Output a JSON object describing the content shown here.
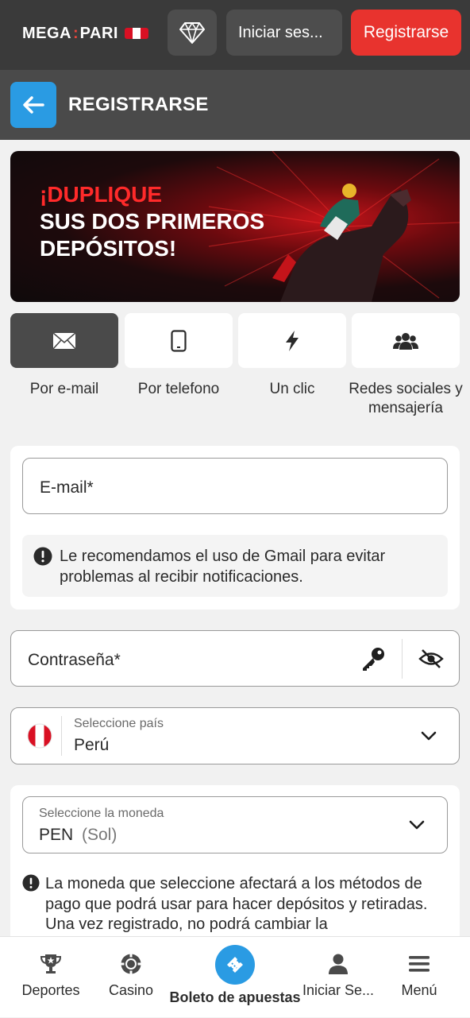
{
  "header": {
    "logo_left": "MEGA",
    "logo_sep": ":",
    "logo_right": "PARI",
    "login_label": "Iniciar ses...",
    "register_label": "Registrarse"
  },
  "subheader": {
    "title": "REGISTRARSE"
  },
  "banner": {
    "line1": "¡DUPLIQUE",
    "line2": "SUS DOS PRIMEROS",
    "line3": "DEPÓSITOS!"
  },
  "methods": [
    {
      "label": "Por e-mail",
      "icon": "envelope-icon",
      "active": true
    },
    {
      "label": "Por telefono",
      "icon": "phone-icon",
      "active": false
    },
    {
      "label": "Un clic",
      "icon": "lightning-icon",
      "active": false
    },
    {
      "label": "Redes sociales y mensajería",
      "icon": "users-icon",
      "active": false
    }
  ],
  "form": {
    "email_placeholder": "E-mail*",
    "gmail_hint": "Le recomendamos el uso de Gmail para evitar problemas al recibir notificaciones.",
    "password_placeholder": "Contraseña*",
    "country_label": "Seleccione país",
    "country_value": "Perú",
    "currency_label": "Seleccione la moneda",
    "currency_code": "PEN",
    "currency_name": "(Sol)",
    "currency_note": "La moneda que seleccione afectará a los métodos de pago que podrá usar para hacer depósitos y retiradas. Una vez registrado, no podrá cambiar la"
  },
  "bottom_nav": [
    {
      "label": "Deportes",
      "icon": "trophy-icon"
    },
    {
      "label": "Casino",
      "icon": "casino-chip-icon"
    },
    {
      "label": "Boleto de apuestas",
      "icon": "ticket-icon"
    },
    {
      "label": "Iniciar Se...",
      "icon": "user-icon"
    },
    {
      "label": "Menú",
      "icon": "hamburger-menu-icon"
    }
  ],
  "colors": {
    "accent_red": "#e8332e",
    "accent_blue": "#2a9be3",
    "header_bg": "#3a3a3a"
  }
}
